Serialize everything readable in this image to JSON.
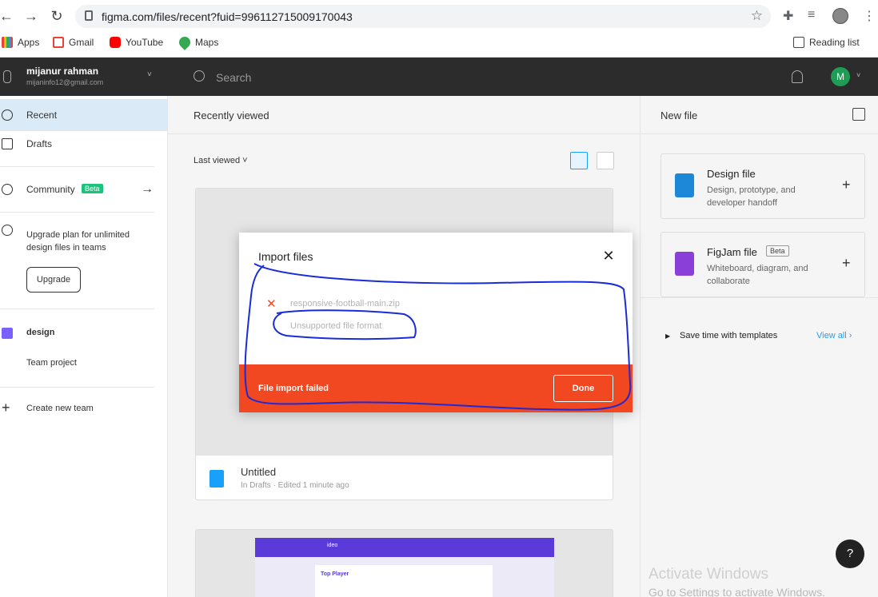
{
  "browser": {
    "url": "figma.com/files/recent?fuid=996112715009170043",
    "bookmarks": [
      {
        "label": "Apps",
        "icon": "apps-grid-icon"
      },
      {
        "label": "Gmail",
        "icon": "gmail-icon"
      },
      {
        "label": "YouTube",
        "icon": "youtube-icon"
      },
      {
        "label": "Maps",
        "icon": "maps-pin-icon"
      }
    ],
    "reading_list": "Reading list"
  },
  "header": {
    "account_name": "mijanur rahman",
    "account_email": "mijaninfo12@gmail.com",
    "search_placeholder": "Search",
    "avatar_letter": "M",
    "avatar_color": "#1f9d55"
  },
  "sidebar": {
    "items": [
      {
        "label": "Recent",
        "icon": "clock-icon",
        "active": true
      },
      {
        "label": "Drafts",
        "icon": "file-icon",
        "active": false
      },
      {
        "label": "Community",
        "icon": "globe-icon",
        "badge": "Beta"
      }
    ],
    "upgrade_text": "Upgrade plan for unlimited design files in teams",
    "upgrade_button": "Upgrade",
    "team_name": "design",
    "team_project": "Team project",
    "create_team": "Create new team"
  },
  "main": {
    "title": "Recently viewed",
    "sort_label": "Last viewed ˅",
    "file": {
      "name": "Untitled",
      "meta": "In Drafts · Edited 1 minute ago"
    },
    "preview2": {
      "nav_text": "ideo",
      "sub_text": "Top Player"
    }
  },
  "right_panel": {
    "title": "New file",
    "cards": [
      {
        "title": "Design file",
        "desc": "Design, prototype, and developer handoff",
        "color": "#1e88d8"
      },
      {
        "title": "FigJam file",
        "badge": "Beta",
        "desc": "Whiteboard, diagram, and collaborate",
        "color": "#8b3fd9"
      }
    ],
    "templates_text": "Save time with templates",
    "view_all": "View all ›",
    "help": "?",
    "watermark_title": "Activate Windows",
    "watermark_sub": "Go to Settings to activate Windows."
  },
  "modal": {
    "title": "Import files",
    "file_name": "responsive-football-main.zip",
    "error_message": "Unsupported file format",
    "footer_text": "File import failed",
    "done_label": "Done",
    "error_color": "#f24822"
  }
}
